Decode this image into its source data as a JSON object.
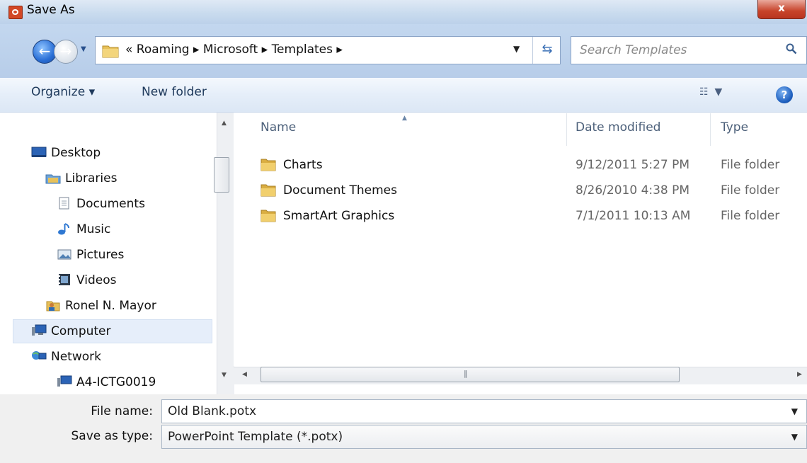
{
  "window": {
    "title": "Save As",
    "close_glyph": "x"
  },
  "address": {
    "path": "« Roaming ▸ Microsoft ▸ Templates ▸",
    "search_placeholder": "Search Templates"
  },
  "toolbar": {
    "organize": "Organize ▾",
    "new_folder": "New folder"
  },
  "nav": {
    "items": [
      {
        "label": "Desktop",
        "icon": "desktop-icon"
      },
      {
        "label": "Libraries",
        "icon": "libraries-icon"
      },
      {
        "label": "Documents",
        "icon": "documents-icon"
      },
      {
        "label": "Music",
        "icon": "music-icon"
      },
      {
        "label": "Pictures",
        "icon": "pictures-icon"
      },
      {
        "label": "Videos",
        "icon": "videos-icon"
      },
      {
        "label": "Ronel N. Mayor",
        "icon": "user-folder-icon"
      },
      {
        "label": "Computer",
        "icon": "computer-icon"
      },
      {
        "label": "Network",
        "icon": "network-icon"
      },
      {
        "label": "A4-ICTG0019",
        "icon": "computer-icon"
      }
    ],
    "selected": "Computer"
  },
  "files": {
    "columns": [
      "Name",
      "Date modified",
      "Type"
    ],
    "rows": [
      {
        "name": "Charts",
        "date": "9/12/2011 5:27 PM",
        "type": "File folder"
      },
      {
        "name": "Document Themes",
        "date": "8/26/2010 4:38 PM",
        "type": "File folder"
      },
      {
        "name": "SmartArt Graphics",
        "date": "7/1/2011 10:13 AM",
        "type": "File folder"
      }
    ]
  },
  "form": {
    "file_name_label": "File name:",
    "file_name_value": "Old Blank.potx",
    "save_type_label": "Save as type:",
    "save_type_value": "PowerPoint Template (*.potx)"
  },
  "colors": {
    "accent": "#1d5fbf",
    "folder": "#e7c15a",
    "close": "#c7432a"
  }
}
